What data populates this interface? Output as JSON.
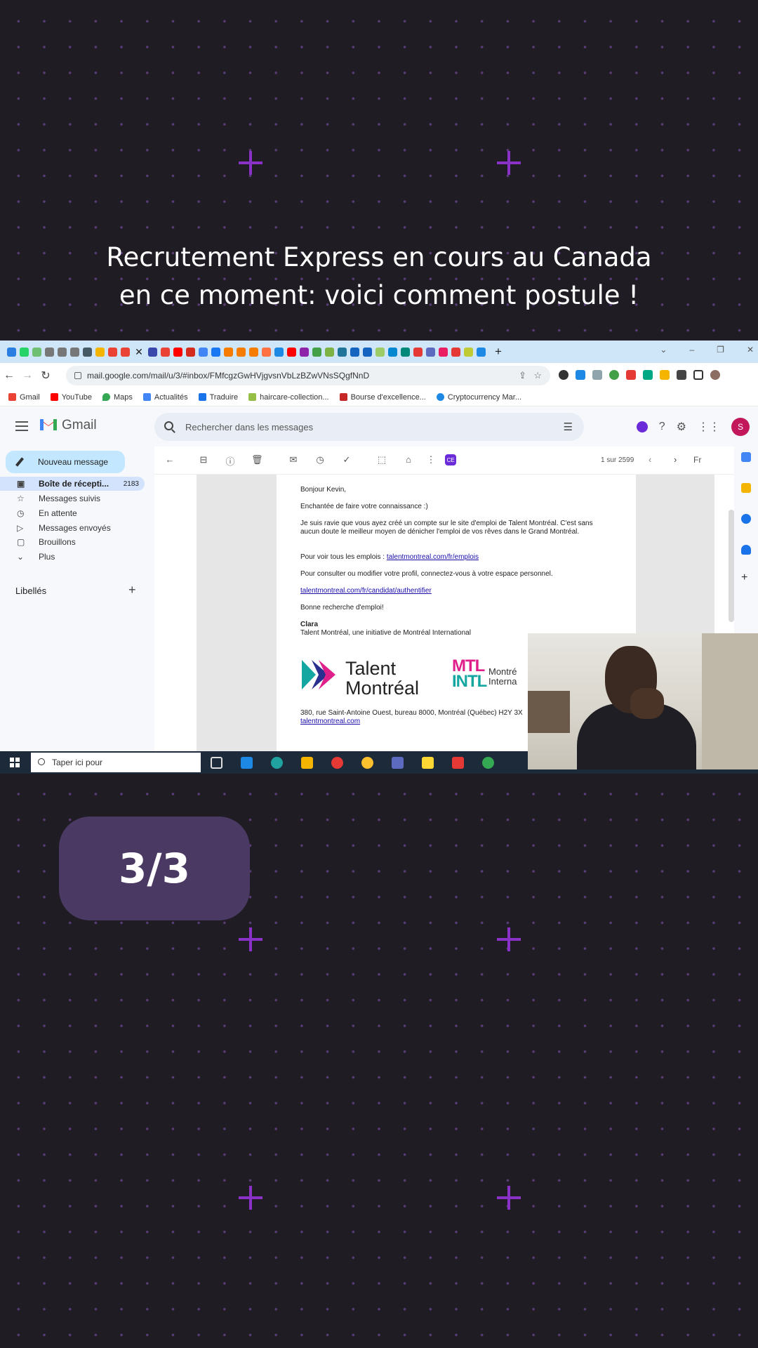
{
  "headline": {
    "line1": "Recrutement Express en cours au Canada",
    "line2": "en ce moment: voici comment postule !"
  },
  "counter": "3/3",
  "browser": {
    "url": "mail.google.com/mail/u/3/#inbox/FMfcgzGwHVjgvsnVbLzBZwVNsSQgfNnD",
    "bookmarks": [
      "Gmail",
      "YouTube",
      "Maps",
      "Actualités",
      "Traduire",
      "haircare-collection...",
      "Bourse d'excellence...",
      "Cryptocurrency Mar..."
    ]
  },
  "gmail": {
    "brand": "Gmail",
    "search_placeholder": "Rechercher dans les messages",
    "compose": "Nouveau message",
    "nav": [
      {
        "label": "Boîte de récepti...",
        "count": "2183"
      },
      {
        "label": "Messages suivis"
      },
      {
        "label": "En attente"
      },
      {
        "label": "Messages envoyés"
      },
      {
        "label": "Brouillons"
      },
      {
        "label": "Plus"
      }
    ],
    "labels_heading": "Libellés",
    "pager": "1 sur 2599",
    "lang": "Fr",
    "avatar": "S"
  },
  "email": {
    "greeting": "Bonjour Kevin,",
    "line1": "Enchantée de faire votre connaissance :)",
    "para1a": "Je suis ravie que vous ayez créé un compte sur le site d'emploi de Talent Montréal. C'est sans",
    "para1b": "aucun doute le meilleur moyen de dénicher l'emploi de vos rêves dans le Grand Montréal.",
    "jobs_prefix": "Pour voir tous les emplois : ",
    "jobs_link": "talentmontreal.com/fr/emplois",
    "profile_text": "Pour consulter ou modifier votre profil, connectez-vous à votre espace personnel.",
    "profile_link": "talentmontreal.com/fr/candidat/authentifier",
    "closing": "Bonne recherche d'emploi!",
    "signer": "Clara",
    "signer_org": "Talent Montréal, une initiative de Montréal International",
    "logo_word1": "Talent",
    "logo_word2": "Montréal",
    "mtl_line1": "MTL",
    "mtl_line2": "INTL",
    "mtl_side1": "Montré",
    "mtl_side2": "Interna",
    "address": "380, rue Saint-Antoine Ouest, bureau 8000, Montréal (Québec) H2Y 3X",
    "footer_link": "talentmontreal.com"
  },
  "taskbar": {
    "search_placeholder": "Taper ici pour"
  },
  "colors": {
    "accent": "#8a32c7",
    "counter_bg": "#4a3962",
    "compose_bg": "#c2e7ff",
    "active_nav": "#d3e3fd"
  }
}
